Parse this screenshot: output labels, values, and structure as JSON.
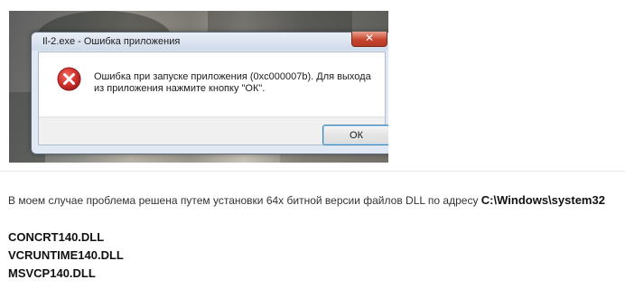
{
  "dialog": {
    "title": "Il-2.exe - Ошибка приложения",
    "message": "Ошибка при запуске приложения (0xc000007b). Для выхода из приложения нажмите кнопку \"ОК\".",
    "ok_label": "ОК",
    "close_symbol": "✕",
    "icon": "error-icon"
  },
  "article": {
    "note_text": "В моем случае проблема решена путем установки 64х битной версии файлов DLL по адресу ",
    "note_path": "C:\\Windows\\system32",
    "dll_files": [
      "CONCRT140.DLL",
      "VCRUNTIME140.DLL",
      "MSVCP140.DLL"
    ]
  },
  "colors": {
    "error_red": "#d0312d",
    "close_red": "#c7452f",
    "ok_border": "#3c7fb1"
  }
}
